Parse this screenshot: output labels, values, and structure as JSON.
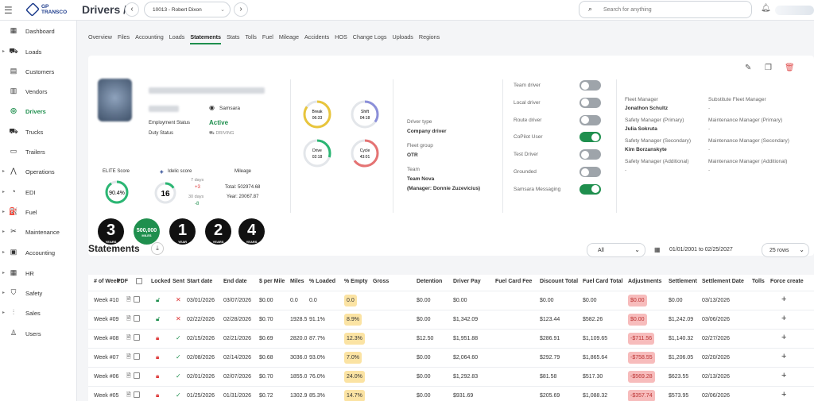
{
  "app": {
    "logo_line1": "GP",
    "logo_line2": "TRANSCO",
    "page_title": "Drivers /",
    "driver_select": "10013 - Robert Dixon",
    "search_placeholder": "Search for anything"
  },
  "sidebar": {
    "items": [
      {
        "label": "Dashboard",
        "icon": "dashboard-icon",
        "glyph": "▦",
        "caret": false
      },
      {
        "label": "Loads",
        "icon": "loads-icon",
        "glyph": "⛟",
        "caret": true
      },
      {
        "label": "Customers",
        "icon": "customers-icon",
        "glyph": "▤",
        "caret": false
      },
      {
        "label": "Vendors",
        "icon": "vendors-icon",
        "glyph": "▥",
        "caret": false
      },
      {
        "label": "Drivers",
        "icon": "drivers-icon",
        "glyph": "◎",
        "caret": false,
        "active": true
      },
      {
        "label": "Trucks",
        "icon": "trucks-icon",
        "glyph": "⛟",
        "caret": false
      },
      {
        "label": "Trailers",
        "icon": "trailers-icon",
        "glyph": "▭",
        "caret": false
      },
      {
        "label": "Operations",
        "icon": "operations-icon",
        "glyph": "⋀",
        "caret": true
      },
      {
        "label": "EDI",
        "icon": "edi-icon",
        "glyph": "◔",
        "caret": true
      },
      {
        "label": "Fuel",
        "icon": "fuel-icon",
        "glyph": "⛽",
        "caret": true
      },
      {
        "label": "Maintenance",
        "icon": "maintenance-icon",
        "glyph": "✂",
        "caret": true
      },
      {
        "label": "Accounting",
        "icon": "accounting-icon",
        "glyph": "▣",
        "caret": true
      },
      {
        "label": "HR",
        "icon": "hr-icon",
        "glyph": "▦",
        "caret": true
      },
      {
        "label": "Safety",
        "icon": "safety-icon",
        "glyph": "⛉",
        "caret": true
      },
      {
        "label": "Sales",
        "icon": "sales-icon",
        "glyph": "⫶",
        "caret": true
      },
      {
        "label": "Users",
        "icon": "users-icon",
        "glyph": "♙",
        "caret": false
      }
    ]
  },
  "tabs": [
    "Overview",
    "Files",
    "Accounting",
    "Loads",
    "Statements",
    "Stats",
    "Tolls",
    "Fuel",
    "Mileage",
    "Accidents",
    "HOS",
    "Change Logs",
    "Uploads",
    "Regions"
  ],
  "active_tab": "Statements",
  "profile": {
    "samsara": "Samsara",
    "employment_status_label": "Employment Status",
    "employment_status": "Active",
    "duty_status_label": "Duty Status",
    "duty_status": "DRIVING",
    "elite_label": "ELITE Score",
    "elite_value": "90.4%",
    "elite_fraction": 0.904,
    "idelic_label": "Idelic score",
    "idelic_value": "16",
    "idelic_fraction": 0.16,
    "idelic_7d_label": "7 days",
    "idelic_7d": "+3",
    "idelic_30d_label": "30 days",
    "idelic_30d": "-8",
    "mileage_label": "Mileage",
    "mileage_total": "Total: 502974.68",
    "mileage_year": "Year: 20067.87"
  },
  "badges": [
    {
      "big": "3",
      "small": "YEARS"
    },
    {
      "big": "500,000",
      "small": "MILES"
    },
    {
      "big": "1",
      "small": "YEAR"
    },
    {
      "big": "2",
      "small": "YEARS"
    },
    {
      "big": "4",
      "small": "YEARS"
    }
  ],
  "hos": [
    {
      "label": "Break",
      "value": "06:33",
      "color": "#e8c53c",
      "fraction": 0.85
    },
    {
      "label": "Shift",
      "value": "04:18",
      "color": "#8b8fd9",
      "fraction": 0.35
    },
    {
      "label": "Drive",
      "value": "02:18",
      "color": "#2bb673",
      "fraction": 0.3
    },
    {
      "label": "Cycle",
      "value": "43:01",
      "color": "#e57373",
      "fraction": 0.65
    }
  ],
  "driver_info": [
    {
      "label": "Driver type",
      "value": "Company driver"
    },
    {
      "label": "Fleet group",
      "value": "OTR"
    },
    {
      "label": "Team",
      "value": "Team Nova",
      "extra": "(Manager: Donnie Zuzevicius)"
    }
  ],
  "toggles": [
    {
      "label": "Team driver",
      "on": false
    },
    {
      "label": "Local driver",
      "on": false
    },
    {
      "label": "Route driver",
      "on": false
    },
    {
      "label": "CoPilot User",
      "on": true
    },
    {
      "label": "Test Driver",
      "on": false
    },
    {
      "label": "Grounded",
      "on": false
    },
    {
      "label": "Samsara Messaging",
      "on": true
    }
  ],
  "managers": {
    "left": [
      {
        "label": "Fleet Manager",
        "value": "Jonathon Schultz"
      },
      {
        "label": "Safety Manager (Primary)",
        "value": "Julia Sokruta"
      },
      {
        "label": "Safety Manager (Secondary)",
        "value": "Kim Borzanskyte"
      },
      {
        "label": "Safety Manager (Additional)",
        "value": "-"
      }
    ],
    "right": [
      {
        "label": "Substitute Fleet Manager",
        "value": "-"
      },
      {
        "label": "Maintenance Manager (Primary)",
        "value": "-"
      },
      {
        "label": "Maintenance Manager (Secondary)",
        "value": "-"
      },
      {
        "label": "Maintenance Manager (Additional)",
        "value": "-"
      }
    ]
  },
  "statements": {
    "title": "Statements",
    "filter": "All",
    "date_range": "01/01/2001 to 02/25/2027",
    "rows_select": "25 rows",
    "columns": [
      "# of Week",
      "PDF",
      "Locked",
      "Sent",
      "Start date",
      "End date",
      "$ per Mile",
      "Miles",
      "% Loaded",
      "% Empty",
      "Gross",
      "Detention",
      "Driver Pay",
      "Fuel Card Fee",
      "Discount Total",
      "Fuel Card Total",
      "Adjustments",
      "Settlement",
      "Settlement Date",
      "Tolls",
      "Force create"
    ],
    "rows": [
      {
        "week": "Week #10",
        "locked": false,
        "sent": false,
        "start": "03/01/2026",
        "end": "03/07/2026",
        "ppm": "$0.00",
        "miles": "0.0",
        "loaded": "0.0",
        "empty": "0.0",
        "gross": "",
        "det": "$0.00",
        "pay": "$0.00",
        "fee": "",
        "disc": "$0.00",
        "fct": "$0.00",
        "adj": "$0.00",
        "settle": "$0.00",
        "sdate": "03/13/2026"
      },
      {
        "week": "Week #09",
        "locked": false,
        "sent": false,
        "start": "02/22/2026",
        "end": "02/28/2026",
        "ppm": "$0.70",
        "miles": "1928.5",
        "loaded": "91.1%",
        "empty": "8.9%",
        "gross": "",
        "det": "$0.00",
        "pay": "$1,342.09",
        "fee": "",
        "disc": "$123.44",
        "fct": "$582.26",
        "adj": "$0.00",
        "settle": "$1,242.09",
        "sdate": "03/06/2026"
      },
      {
        "week": "Week #08",
        "locked": true,
        "sent": true,
        "start": "02/15/2026",
        "end": "02/21/2026",
        "ppm": "$0.69",
        "miles": "2820.0",
        "loaded": "87.7%",
        "empty": "12.3%",
        "gross": "",
        "det": "$12.50",
        "pay": "$1,951.88",
        "fee": "",
        "disc": "$286.91",
        "fct": "$1,109.65",
        "adj": "-$711.56",
        "settle": "$1,140.32",
        "sdate": "02/27/2026"
      },
      {
        "week": "Week #07",
        "locked": true,
        "sent": true,
        "start": "02/08/2026",
        "end": "02/14/2026",
        "ppm": "$0.68",
        "miles": "3036.0",
        "loaded": "93.0%",
        "empty": "7.0%",
        "gross": "",
        "det": "$0.00",
        "pay": "$2,064.60",
        "fee": "",
        "disc": "$292.79",
        "fct": "$1,865.64",
        "adj": "-$758.55",
        "settle": "$1,206.05",
        "sdate": "02/20/2026"
      },
      {
        "week": "Week #06",
        "locked": true,
        "sent": true,
        "start": "02/01/2026",
        "end": "02/07/2026",
        "ppm": "$0.70",
        "miles": "1855.0",
        "loaded": "76.0%",
        "empty": "24.0%",
        "gross": "",
        "det": "$0.00",
        "pay": "$1,292.83",
        "fee": "",
        "disc": "$81.58",
        "fct": "$517.30",
        "adj": "-$569.28",
        "settle": "$623.55",
        "sdate": "02/13/2026"
      },
      {
        "week": "Week #05",
        "locked": true,
        "sent": true,
        "start": "01/25/2026",
        "end": "01/31/2026",
        "ppm": "$0.72",
        "miles": "1302.9",
        "loaded": "85.3%",
        "empty": "14.7%",
        "gross": "",
        "det": "$0.00",
        "pay": "$931.69",
        "fee": "",
        "disc": "$205.69",
        "fct": "$1,088.32",
        "adj": "-$357.74",
        "settle": "$573.95",
        "sdate": "02/06/2026"
      }
    ]
  }
}
